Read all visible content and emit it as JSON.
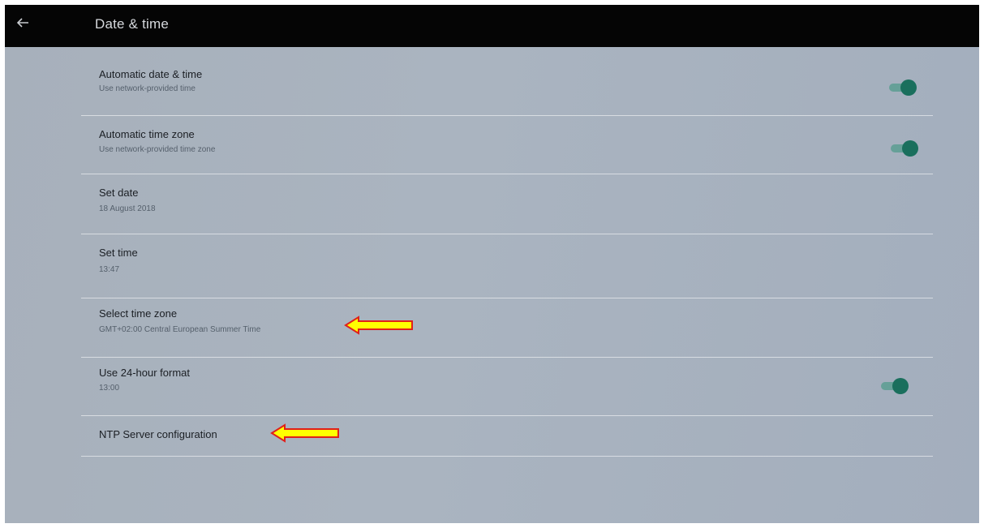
{
  "header": {
    "title": "Date & time",
    "back_icon": "arrow-back-icon"
  },
  "settings": [
    {
      "title": "Automatic date & time",
      "subtitle": "Use network-provided time",
      "toggle": true,
      "toggle_on": true
    },
    {
      "title": "Automatic time zone",
      "subtitle": "Use network-provided time zone",
      "toggle": true,
      "toggle_on": true
    },
    {
      "title": "Set date",
      "subtitle": "18 August 2018",
      "toggle": false
    },
    {
      "title": "Set time",
      "subtitle": "13:47",
      "toggle": false
    },
    {
      "title": "Select time zone",
      "subtitle": "GMT+02:00 Central European Summer Time",
      "toggle": false,
      "annotation_arrow": true
    },
    {
      "title": "Use 24-hour format",
      "subtitle": "13:00",
      "toggle": true,
      "toggle_on": true
    },
    {
      "title": "NTP Server configuration",
      "toggle": false,
      "annotation_arrow": true
    }
  ],
  "colors": {
    "app_bar": "#050505",
    "background": "#aab4c0",
    "toggle_thumb": "#1a6f5d",
    "toggle_track": "#5f9e93",
    "annotation_arrow_fill": "#ffff00",
    "annotation_arrow_border": "#e0201a"
  }
}
